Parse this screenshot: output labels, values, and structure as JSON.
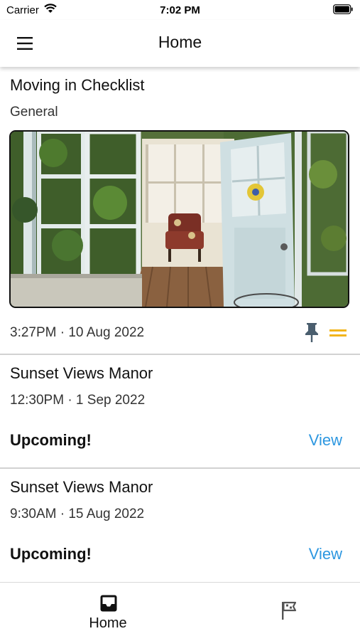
{
  "status_bar": {
    "carrier": "Carrier",
    "time": "7:02 PM"
  },
  "header": {
    "title": "Home",
    "menu_icon": "hamburger-menu-icon"
  },
  "featured_card": {
    "title": "Moving in Checklist",
    "category": "General",
    "image_description_icon": "greenhouse-photo",
    "timestamp": "3:27PM · 10 Aug 2022",
    "pin_icon": "pin-icon",
    "drag_icon": "drag-handle-icon",
    "accent_color": "#f2b51b"
  },
  "events": [
    {
      "title": "Sunset Views Manor",
      "datetime": "12:30PM · 1 Sep 2022",
      "status": "Upcoming!",
      "action": "View"
    },
    {
      "title": "Sunset Views Manor",
      "datetime": "9:30AM · 15 Aug 2022",
      "status": "Upcoming!",
      "action": "View"
    }
  ],
  "tab_bar": {
    "tabs": [
      {
        "label": "Home",
        "icon": "inbox-icon",
        "active": true
      },
      {
        "label": "",
        "icon": "flag-icon",
        "active": false
      }
    ]
  },
  "colors": {
    "link": "#2d97e0",
    "divider": "#d2d2d2",
    "pin": "#4a5e6e"
  }
}
